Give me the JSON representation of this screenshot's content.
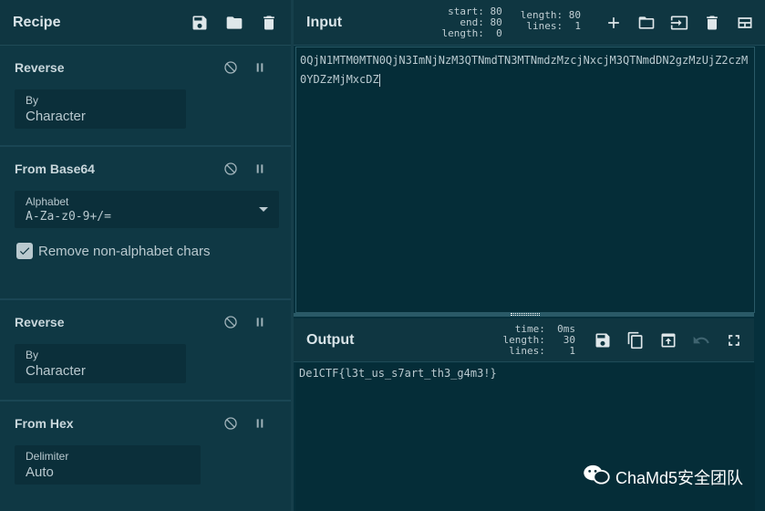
{
  "recipe": {
    "title": "Recipe",
    "operations": [
      {
        "name": "Reverse",
        "field_label": "By",
        "field_value": "Character"
      },
      {
        "name": "From Base64",
        "field_label": "Alphabet",
        "field_value": "A-Za-z0-9+/=",
        "checkbox_label": "Remove non-alphabet chars"
      },
      {
        "name": "Reverse",
        "field_label": "By",
        "field_value": "Character"
      },
      {
        "name": "From Hex",
        "field_label": "Delimiter",
        "field_value": "Auto"
      }
    ]
  },
  "input": {
    "title": "Input",
    "stats_left": [
      "start: 80",
      "  end: 80",
      "length:  0"
    ],
    "stats_right": [
      "length: 80",
      " lines:  1"
    ],
    "text": "0QjN1MTM0MTN0QjN3ImNjNzM3QTNmdTN3MTNmdzMzcjNxcjM3QTNmdDN2gzMzUjZ2czM0YDZzMjMxcDZ"
  },
  "output": {
    "title": "Output",
    "stats": [
      "  time:  0ms",
      "length:   30",
      " lines:    1"
    ],
    "text": "De1CTF{l3t_us_s7art_th3_g4m3!}"
  },
  "watermark": {
    "text": "ChaMd5安全团队"
  }
}
